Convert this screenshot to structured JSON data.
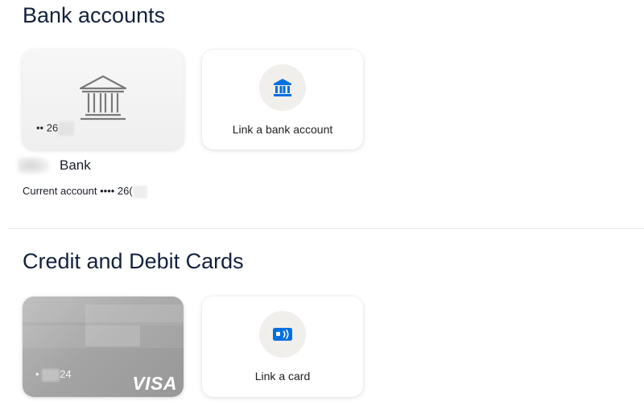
{
  "bank_section": {
    "title": "Bank accounts",
    "account_tile": {
      "icon": "bank-building-icon",
      "masked_number": "•• 26"
    },
    "link_tile": {
      "icon": "bank-icon",
      "icon_color": "#0070e0",
      "label": "Link a bank account"
    },
    "bank_name": "Bank",
    "account_description": "Current account •••• 26("
  },
  "cards_section": {
    "title": "Credit and Debit Cards",
    "card_tile": {
      "masked_number": "•",
      "last_digits": "24",
      "brand": "VISA"
    },
    "link_tile": {
      "icon": "card-icon",
      "icon_color": "#0070e0",
      "label": "Link a card"
    }
  }
}
